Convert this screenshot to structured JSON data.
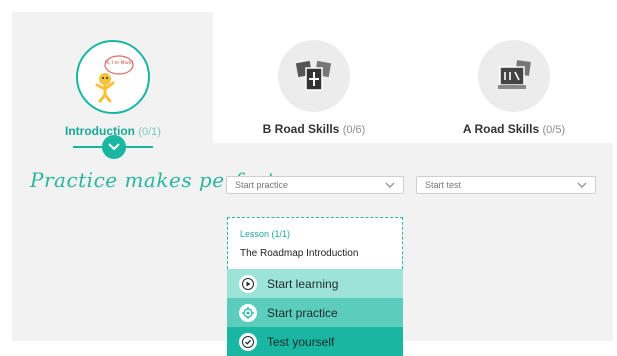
{
  "sections": [
    {
      "title": "Introduction",
      "count": "(0/1)",
      "active": true
    },
    {
      "title": "B Road Skills",
      "count": "(0/6)",
      "active": false
    },
    {
      "title": "A Road Skills",
      "count": "(0/5)",
      "active": false
    }
  ],
  "mascot": {
    "speech": "Hi, I'm Mark!"
  },
  "tagline": "Practice makes perfect:",
  "dropdowns": {
    "practice": {
      "value": "Start practice"
    },
    "test": {
      "value": "Start test"
    }
  },
  "menu": {
    "lesson": "Lesson (1/1)",
    "title": "The Roadmap Introduction",
    "items": [
      {
        "label": "Start learning",
        "icon": "play-icon",
        "color": "#9ee3d8"
      },
      {
        "label": "Start practice",
        "icon": "target-icon",
        "color": "#5ccdbd"
      },
      {
        "label": "Test yourself",
        "icon": "check-icon",
        "color": "#19b6a1"
      }
    ]
  },
  "colors": {
    "accent": "#19b6a1",
    "panel": "#f2f2f2"
  }
}
